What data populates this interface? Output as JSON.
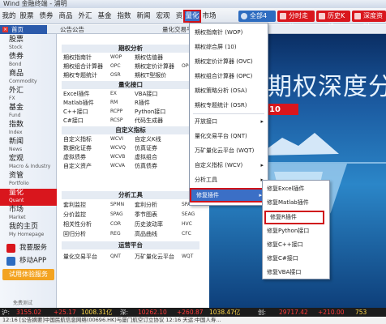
{
  "window": {
    "title": "Wind 金融终端 - 浦明"
  },
  "menubar": {
    "items": [
      "我的",
      "股票",
      "债券",
      "商品",
      "外汇",
      "基金",
      "指数",
      "新闻",
      "宏观",
      "资讯",
      "量化",
      "市场"
    ],
    "active": "量化",
    "buttons": [
      {
        "label": "全部4窗",
        "color": "#2d6cc0"
      },
      {
        "label": "分时走势",
        "color": "#d9161d"
      },
      {
        "label": "历史K线",
        "color": "#d9161d"
      },
      {
        "label": "深度资料",
        "color": "#d9161d"
      }
    ]
  },
  "tabs": [
    {
      "label": "首页"
    },
    {
      "label": "公告公告"
    },
    {
      "label": "量化交易平台"
    }
  ],
  "sidebar": {
    "items": [
      {
        "cn": "股票",
        "en": "Stock"
      },
      {
        "cn": "债券",
        "en": "Bond"
      },
      {
        "cn": "商品",
        "en": "Commodity"
      },
      {
        "cn": "外汇",
        "en": "FX"
      },
      {
        "cn": "基金",
        "en": "Fund"
      },
      {
        "cn": "指数",
        "en": "Index"
      },
      {
        "cn": "新闻",
        "en": "News"
      },
      {
        "cn": "宏观",
        "en": "Macro & Industry"
      },
      {
        "cn": "资管",
        "en": "Portfolio"
      },
      {
        "cn": "量化",
        "en": "Quant"
      },
      {
        "cn": "市场",
        "en": "Market"
      },
      {
        "cn": "我的主页",
        "en": "My Homepage"
      }
    ],
    "active_index": 9,
    "service": "我要服务",
    "mobile": "移动APP",
    "trial": "试用体验服务",
    "footer": "免费测试"
  },
  "quant_grid": {
    "sections": [
      {
        "title": "期权分析",
        "rows": [
          [
            "期权指南针",
            "WOP",
            "期权估值器",
            ""
          ],
          [
            "期权组合计算器",
            "OPC",
            "期权定价计算器",
            "OPCC"
          ],
          [
            "期权专题统计",
            "OSR",
            "期权T型报价",
            ""
          ]
        ]
      },
      {
        "title": "量化接口",
        "rows": [
          [
            "Excel插件",
            "EX",
            "VBA接口",
            ""
          ],
          [
            "Matlab插件",
            "RM",
            "R插件",
            ""
          ],
          [
            "C++接口",
            "RCPP",
            "Python接口",
            ""
          ],
          [
            "C#接口",
            "RCSP",
            "代码生成器",
            ""
          ]
        ]
      },
      {
        "title": "自定义指标",
        "rows": [
          [
            "自定义指标",
            "WCVI",
            "自定义K线",
            ""
          ],
          [
            "数据化证券",
            "WCVQ",
            "仿真证券",
            ""
          ],
          [
            "虚拟债券",
            "WCVB",
            "虚拟组合",
            ""
          ],
          [
            "自定义资产",
            "WCVA",
            "仿真债券",
            ""
          ]
        ]
      },
      {
        "title": "分析工具",
        "rows": [
          [
            "套利监控",
            "SPMN",
            "套利分析",
            "SPAN"
          ],
          [
            "分价监控",
            "SPAG",
            "季节图表",
            "SEAG"
          ],
          [
            "相关性分析",
            "COR",
            "历史波动率",
            "HVC"
          ],
          [
            "回归分析",
            "REG",
            "高品曲线",
            "CFC"
          ]
        ]
      },
      {
        "title": "运营平台",
        "rows": [
          [
            "量化交易平台",
            "QNT",
            "万矿量化云平台",
            "WQT"
          ]
        ]
      }
    ]
  },
  "banner": {
    "title": "期权深度分",
    "badge": "10"
  },
  "dropdown": {
    "items": [
      {
        "label": "期权指南针 (WOP)",
        "arrow": false
      },
      {
        "label": "期权综合屏 (10)",
        "arrow": false
      },
      {
        "label": "期权定价计算器 (OVC)",
        "arrow": false
      },
      {
        "label": "期权组合计算器 (OPC)",
        "arrow": false
      },
      {
        "label": "期权策略分析 (OSA)",
        "arrow": false
      },
      {
        "label": "期权专题统计 (OSR)",
        "arrow": false
      },
      {
        "label": "开放接口",
        "arrow": true
      },
      {
        "label": "量化交易平台 (QNT)",
        "arrow": false
      },
      {
        "label": "万矿量化云平台 (WQT)",
        "arrow": false
      },
      {
        "label": "自定义指标 (WCV)",
        "arrow": true
      },
      {
        "label": "分析工具",
        "arrow": true
      },
      {
        "label": "修复插件",
        "arrow": true
      }
    ],
    "selected_index": 11
  },
  "submenu": {
    "items": [
      "修复Excel插件",
      "修复Matlab插件",
      "修复R插件",
      "修复Python接口",
      "修复C++接口",
      "修复C#接口",
      "修复VBA接口"
    ],
    "selected_index": 2
  },
  "statusbar": {
    "items": [
      {
        "label": "沪:",
        "value": "3155.02",
        "change": "+25.17",
        "amount": "1008.31亿"
      },
      {
        "label": "深:",
        "value": "10262.10",
        "change": "+260.87",
        "amount": "1038.47亿"
      },
      {
        "label": "创:",
        "value": "29717.42",
        "change": "+210.00",
        "amount": "753"
      }
    ]
  },
  "ticker": "12:16 [公告摘要]中国民航信息网络(00696.HK)与厦门航空订立协议 12:16 天运:中国人寿..."
}
